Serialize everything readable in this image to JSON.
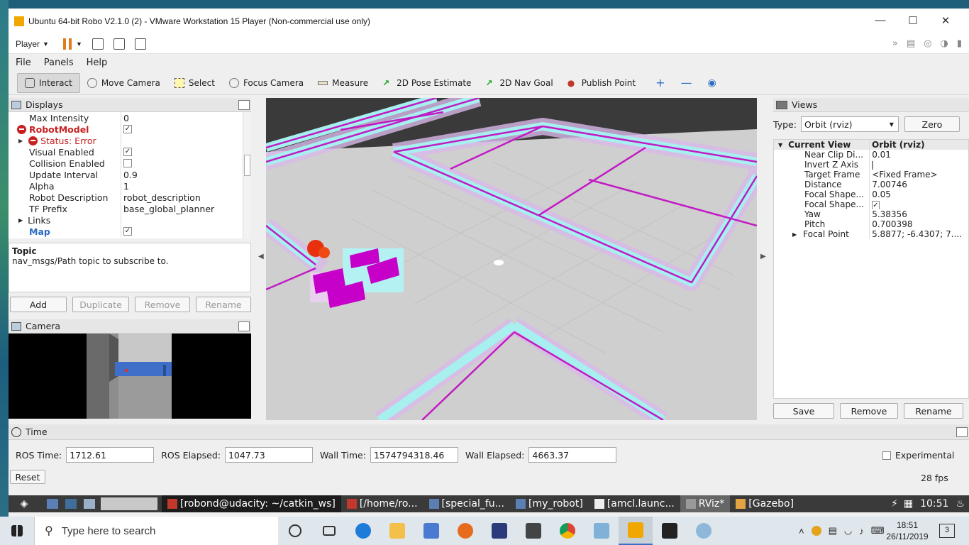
{
  "window": {
    "title": "Ubuntu 64-bit Robo V2.1.0 (2) - VMware Workstation 15 Player (Non-commercial use only)",
    "player_label": "Player"
  },
  "menu": [
    "File",
    "Panels",
    "Help"
  ],
  "tools": [
    "Interact",
    "Move Camera",
    "Select",
    "Focus Camera",
    "Measure",
    "2D Pose Estimate",
    "2D Nav Goal",
    "Publish Point"
  ],
  "displays": {
    "title": "Displays",
    "rows": [
      {
        "key": "Max Intensity",
        "value": "0"
      },
      {
        "key": "RobotModel",
        "checkbox": true
      },
      {
        "key": "Status: Error",
        "value": ""
      },
      {
        "key": "Visual Enabled",
        "checkbox": true
      },
      {
        "key": "Collision Enabled",
        "checkbox": false
      },
      {
        "key": "Update Interval",
        "value": "0.9"
      },
      {
        "key": "Alpha",
        "value": "1"
      },
      {
        "key": "Robot Description",
        "value": "robot_description"
      },
      {
        "key": "TF Prefix",
        "value": "base_global_planner"
      },
      {
        "key": "Links",
        "value": ""
      },
      {
        "key": "Map",
        "checkbox": true
      }
    ],
    "topic_title": "Topic",
    "topic_desc": "nav_msgs/Path topic to subscribe to.",
    "buttons": [
      "Add",
      "Duplicate",
      "Remove",
      "Rename"
    ]
  },
  "camera": {
    "title": "Camera"
  },
  "views": {
    "title": "Views",
    "type_label": "Type:",
    "type_value": "Orbit (rviz)",
    "zero_label": "Zero",
    "current_view": "Current View",
    "current_view_value": "Orbit (rviz)",
    "rows": [
      {
        "key": "Near Clip Di...",
        "value": "0.01"
      },
      {
        "key": "Invert Z Axis",
        "value": "",
        "checkbox": false
      },
      {
        "key": "Target Frame",
        "value": "<Fixed Frame>"
      },
      {
        "key": "Distance",
        "value": "7.00746"
      },
      {
        "key": "Focal Shape...",
        "value": "0.05"
      },
      {
        "key": "Focal Shape...",
        "value": "",
        "checkbox": true
      },
      {
        "key": "Yaw",
        "value": "5.38356"
      },
      {
        "key": "Pitch",
        "value": "0.700398"
      },
      {
        "key": "Focal Point",
        "value": "5.8877; -6.4307; 7...."
      }
    ],
    "buttons": [
      "Save",
      "Remove",
      "Rename"
    ]
  },
  "time": {
    "title": "Time",
    "ros_time_label": "ROS Time:",
    "ros_time": "1712.61",
    "ros_elapsed_label": "ROS Elapsed:",
    "ros_elapsed": "1047.73",
    "wall_time_label": "Wall Time:",
    "wall_time": "1574794318.46",
    "wall_elapsed_label": "Wall Elapsed:",
    "wall_elapsed": "4663.37",
    "experimental_label": "Experimental",
    "reset_label": "Reset",
    "fps": "28 fps"
  },
  "guest_taskbar": {
    "items": [
      "[robond@udacity: ~/catkin_ws]",
      "[/home/ro...",
      "[special_fu...",
      "[my_robot]",
      "[amcl.launc...",
      "RViz*",
      "[Gazebo]"
    ],
    "clock": "10:51"
  },
  "win_taskbar": {
    "search_placeholder": "Type here to search",
    "time": "18:51",
    "date": "26/11/2019",
    "notif_count": "3"
  }
}
